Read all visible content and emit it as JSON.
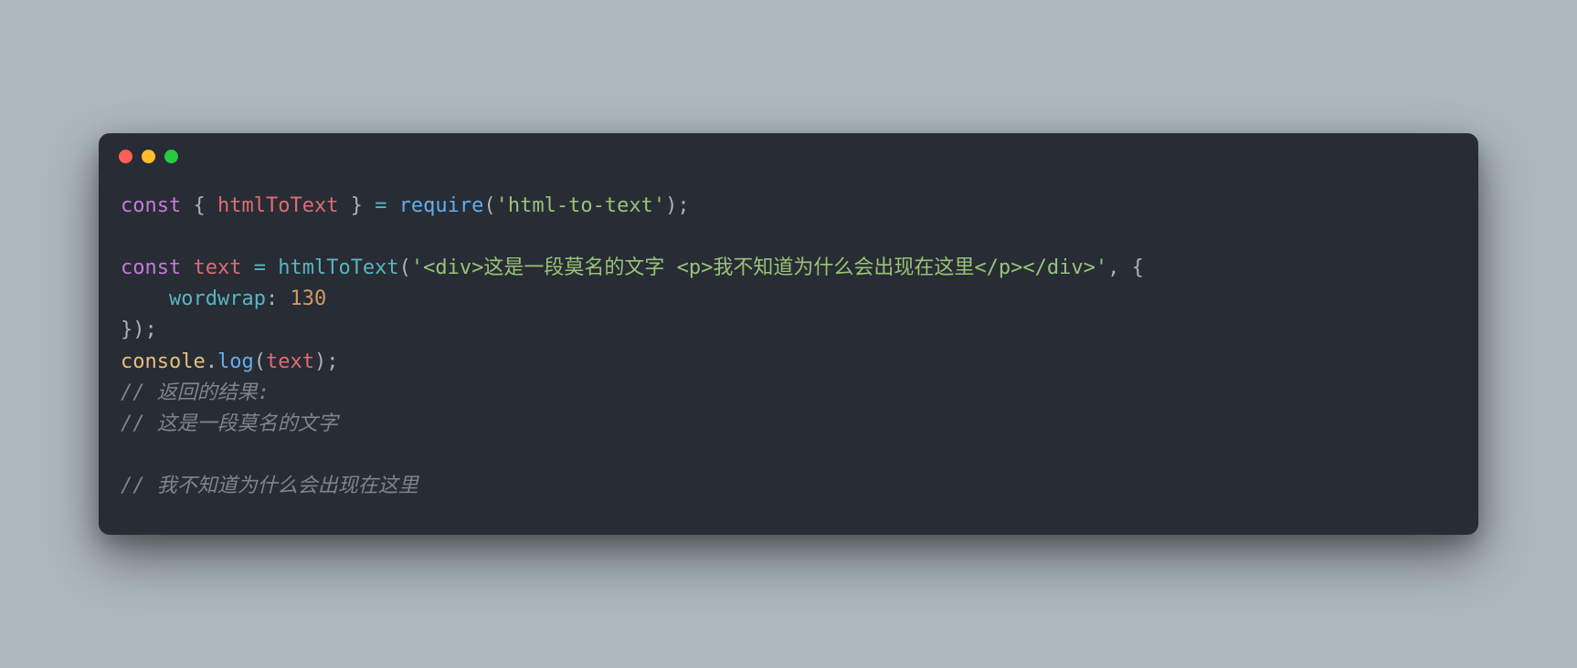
{
  "window": {
    "traffic_lights": [
      "red",
      "yellow",
      "green"
    ]
  },
  "code": {
    "line1": {
      "kw": "const",
      "brace_open": " { ",
      "ident": "htmlToText",
      "brace_close": " } ",
      "op_eq": "= ",
      "fn": "require",
      "paren_open": "(",
      "str": "'html-to-text'",
      "paren_close_semi": ");"
    },
    "line2": "",
    "line3": {
      "kw": "const",
      "sp": " ",
      "ident": "text",
      "sp2": " ",
      "op_eq": "= ",
      "fn": "htmlToText",
      "paren_open": "(",
      "str": "'<div>这是一段莫名的文字 <p>我不知道为什么会出现在这里</p></div>'",
      "comma_brace": ", {"
    },
    "line4": {
      "indent": "    ",
      "key": "wordwrap",
      "colon": ": ",
      "num": "130"
    },
    "line5": {
      "close": "});"
    },
    "line6": {
      "obj": "console",
      "dot": ".",
      "method": "log",
      "paren_open": "(",
      "arg": "text",
      "paren_close_semi": ");"
    },
    "line7": {
      "comment": "// 返回的结果:"
    },
    "line8": {
      "comment": "// 这是一段莫名的文字"
    },
    "line9": "",
    "line10": {
      "comment": "// 我不知道为什么会出现在这里"
    }
  }
}
